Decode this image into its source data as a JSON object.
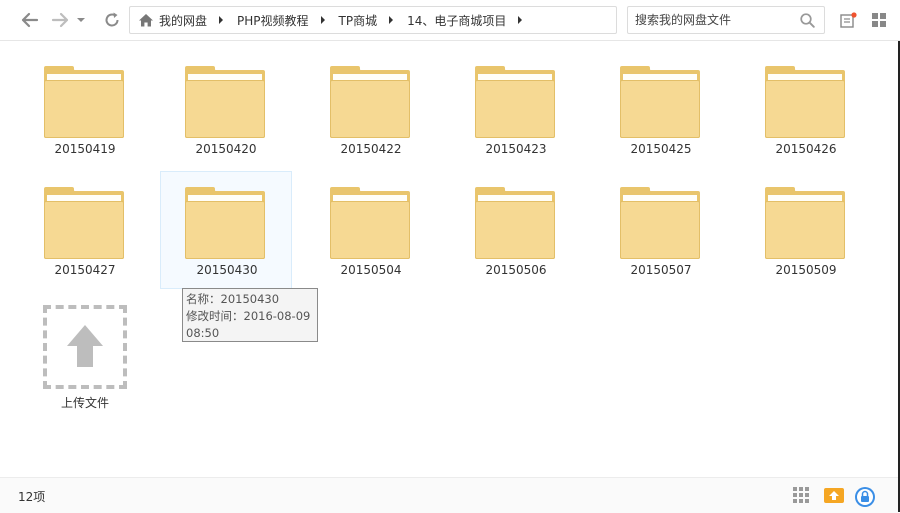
{
  "nav": {
    "back_icon": "arrow-left-icon",
    "forward_icon": "arrow-right-icon",
    "history_icon": "chevron-down-icon",
    "refresh_icon": "refresh-icon"
  },
  "breadcrumb": {
    "home_icon": "home-icon",
    "items": [
      {
        "label": "我的网盘"
      },
      {
        "label": "PHP视频教程"
      },
      {
        "label": "TP商城"
      },
      {
        "label": "14、电子商城项目"
      }
    ]
  },
  "search": {
    "placeholder": "搜索我的网盘文件",
    "value": ""
  },
  "folders": [
    {
      "name": "20150419"
    },
    {
      "name": "20150420"
    },
    {
      "name": "20150422"
    },
    {
      "name": "20150423"
    },
    {
      "name": "20150425"
    },
    {
      "name": "20150426"
    },
    {
      "name": "20150427"
    },
    {
      "name": "20150430",
      "selected": true
    },
    {
      "name": "20150504"
    },
    {
      "name": "20150506"
    },
    {
      "name": "20150507"
    },
    {
      "name": "20150509"
    }
  ],
  "tooltip": {
    "name_line": "名称：20150430",
    "modified_line": "修改时间：2016-08-09",
    "modified_time": "08:50"
  },
  "upload": {
    "label": "上传文件"
  },
  "status": {
    "count": "12项"
  },
  "colors": {
    "folder_front": "#f6d993",
    "folder_back": "#e9c56c",
    "accent_orange": "#f5a623",
    "accent_blue": "#3a8ee6",
    "notification_dot": "#f0532f"
  }
}
